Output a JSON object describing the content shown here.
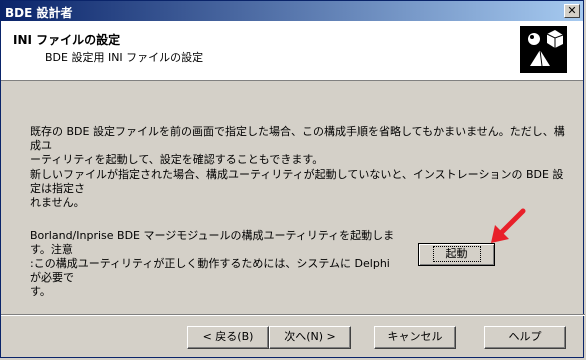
{
  "window": {
    "title": "BDE 設計者"
  },
  "header": {
    "title": "INI ファイルの設定",
    "subtitle": "BDE 設定用 INI ファイルの設定"
  },
  "body": {
    "para1_line1": "既存の BDE 設定ファイルを前の画面で指定した場合、この構成手順を省略してもかまいません。ただし、構成ユ",
    "para1_line2": "ーティリティを起動して、設定を確認することもできます。",
    "para2_line1": "新しいファイルが指定された場合、構成ユーティリティが起動していないと、インストレーションの BDE 設定は指定さ",
    "para2_line2": "れません。",
    "para3_line1": "Borland/Inprise BDE マージモジュールの構成ユーティリティを起動します。注意",
    "para3_line2": ":この構成ユーティリティが正しく動作するためには、システムに Delphi が必要で",
    "para3_line3": "す。"
  },
  "buttons": {
    "launch": "起動",
    "back": "< 戻る(B)",
    "next": "次へ(N) >",
    "cancel": "キャンセル",
    "help": "ヘルプ"
  },
  "colors": {
    "arrow": "#e8202a",
    "titlebar": "#0a246a"
  },
  "icons": {
    "logo": "shapes-logo-icon",
    "close": "close-icon",
    "annotation": "red-arrow-icon"
  }
}
